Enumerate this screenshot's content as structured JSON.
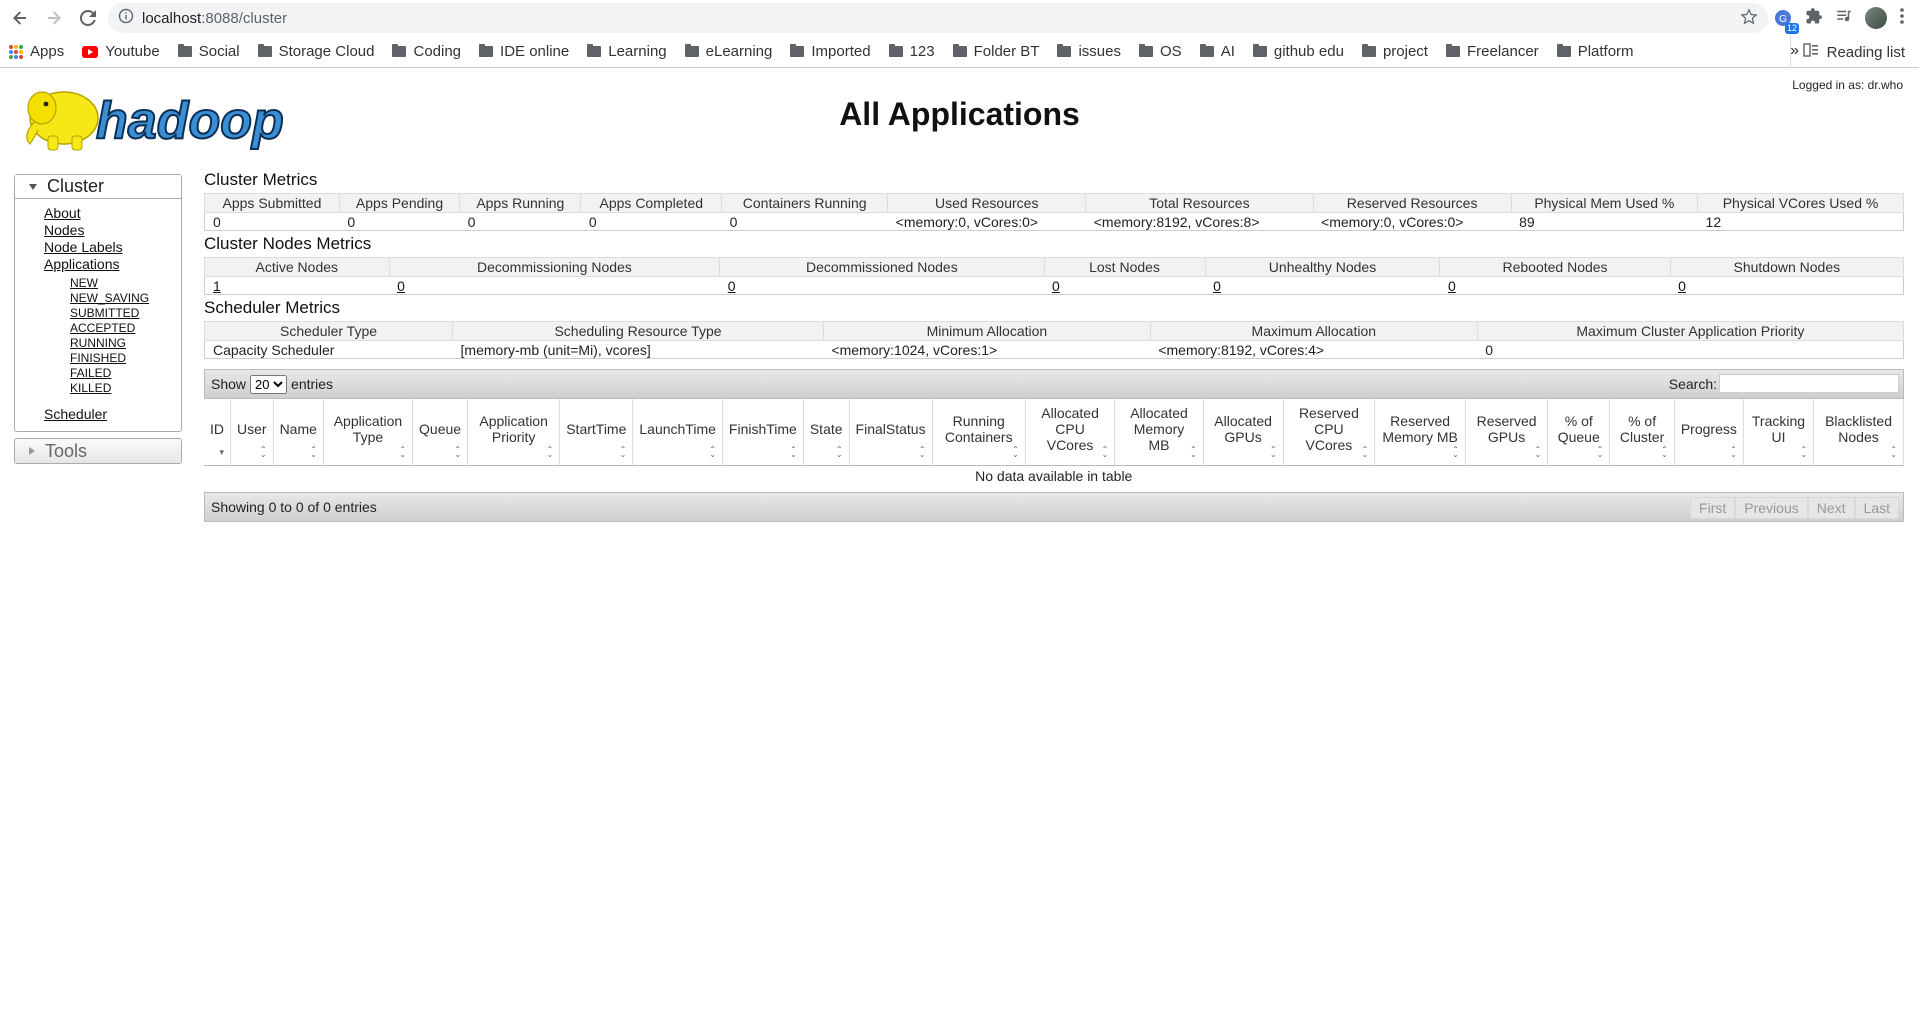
{
  "browser": {
    "url_host": "localhost",
    "url_path": ":8088/cluster",
    "extension_badge": "12",
    "bookmarks": [
      "Apps",
      "Youtube",
      "Social",
      "Storage Cloud",
      "Coding",
      "IDE online",
      "Learning",
      "eLearning",
      "Imported",
      "123",
      "Folder BT",
      "issues",
      "OS",
      "AI",
      "github edu",
      "project",
      "Freelancer",
      "Platform"
    ],
    "more": "»",
    "reading_list": "Reading list"
  },
  "header": {
    "title": "All Applications",
    "logged_in": "Logged in as: dr.who"
  },
  "sidebar": {
    "cluster_label": "Cluster",
    "links": [
      "About",
      "Nodes",
      "Node Labels",
      "Applications"
    ],
    "app_states": [
      "NEW",
      "NEW_SAVING",
      "SUBMITTED",
      "ACCEPTED",
      "RUNNING",
      "FINISHED",
      "FAILED",
      "KILLED"
    ],
    "scheduler": "Scheduler",
    "tools_label": "Tools"
  },
  "cluster_metrics": {
    "title": "Cluster Metrics",
    "headers": [
      "Apps Submitted",
      "Apps Pending",
      "Apps Running",
      "Apps Completed",
      "Containers Running",
      "Used Resources",
      "Total Resources",
      "Reserved Resources",
      "Physical Mem Used %",
      "Physical VCores Used %"
    ],
    "values": [
      "0",
      "0",
      "0",
      "0",
      "0",
      "<memory:0, vCores:0>",
      "<memory:8192, vCores:8>",
      "<memory:0, vCores:0>",
      "89",
      "12"
    ]
  },
  "node_metrics": {
    "title": "Cluster Nodes Metrics",
    "headers": [
      "Active Nodes",
      "Decommissioning Nodes",
      "Decommissioned Nodes",
      "Lost Nodes",
      "Unhealthy Nodes",
      "Rebooted Nodes",
      "Shutdown Nodes"
    ],
    "values": [
      "1",
      "0",
      "0",
      "0",
      "0",
      "0",
      "0"
    ]
  },
  "scheduler_metrics": {
    "title": "Scheduler Metrics",
    "headers": [
      "Scheduler Type",
      "Scheduling Resource Type",
      "Minimum Allocation",
      "Maximum Allocation",
      "Maximum Cluster Application Priority"
    ],
    "values": [
      "Capacity Scheduler",
      "[memory-mb (unit=Mi), vcores]",
      "<memory:1024, vCores:1>",
      "<memory:8192, vCores:4>",
      "0"
    ]
  },
  "apps_table": {
    "show_label": "Show",
    "entries_value": "20",
    "entries_label": "entries",
    "search_label": "Search:",
    "columns": [
      "ID",
      "User",
      "Name",
      "Application Type",
      "Queue",
      "Application Priority",
      "StartTime",
      "LaunchTime",
      "FinishTime",
      "State",
      "FinalStatus",
      "Running Containers",
      "Allocated CPU VCores",
      "Allocated Memory MB",
      "Allocated GPUs",
      "Reserved CPU VCores",
      "Reserved Memory MB",
      "Reserved GPUs",
      "% of Queue",
      "% of Cluster",
      "Progress",
      "Tracking UI",
      "Blacklisted Nodes"
    ],
    "empty_message": "No data available in table",
    "info": "Showing 0 to 0 of 0 entries",
    "pager": [
      "First",
      "Previous",
      "Next",
      "Last"
    ]
  }
}
